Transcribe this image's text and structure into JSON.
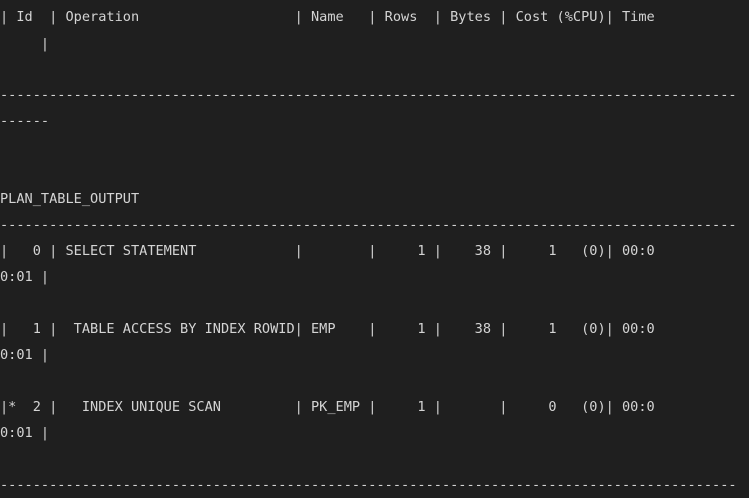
{
  "terminal": {
    "lines": [
      "| Id  | Operation                   | Name   | Rows  | Bytes | Cost (%CPU)| Time",
      "     |",
      "",
      "",
      "------------------------------------------------------------------------------------------",
      "------",
      "",
      "",
      "",
      "PLAN_TABLE_OUTPUT",
      "------------------------------------------------------------------------------------------",
      "|   0 | SELECT STATEMENT            |        |     1 |    38 |     1   (0)| 00:0",
      "0:01 |",
      "",
      "|   1 |  TABLE ACCESS BY INDEX ROWID| EMP    |     1 |    38 |     1   (0)| 00:0",
      "0:01 |",
      "",
      "|*  2 |   INDEX UNIQUE SCAN         | PK_EMP |     1 |       |     0   (0)| 00:0",
      "0:01 |",
      "",
      "",
      "------------------------------------------------------------------------------------------"
    ]
  }
}
